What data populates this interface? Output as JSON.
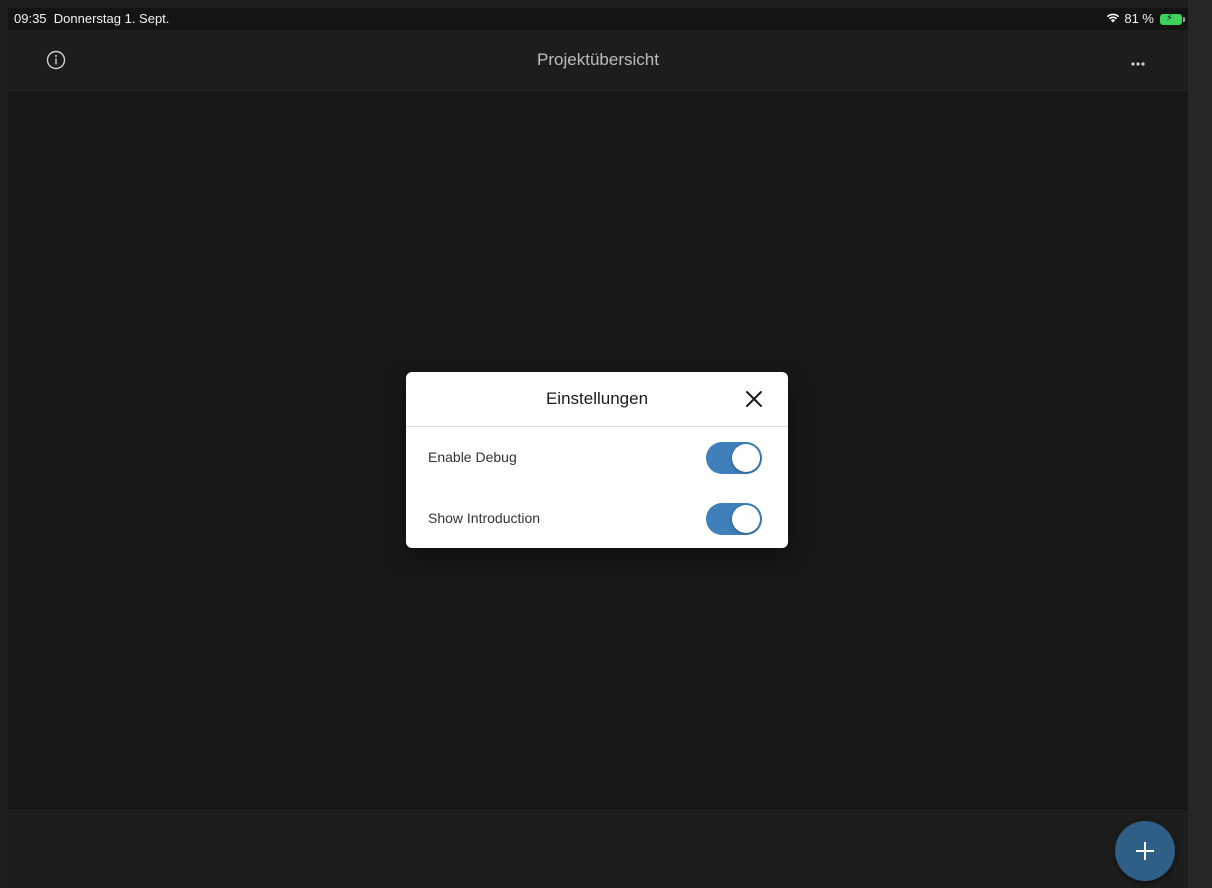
{
  "status_bar": {
    "time": "09:35",
    "date": "Donnerstag 1. Sept.",
    "wifi_icon": "wifi-icon",
    "battery_percent": "81 %",
    "battery_icon": "battery-charging-icon"
  },
  "navbar": {
    "title": "Projektübersicht",
    "info_icon": "info-icon",
    "more_icon": "more-horizontal-icon"
  },
  "settings_dialog": {
    "title": "Einstellungen",
    "close_icon": "close-icon",
    "options": [
      {
        "label": "Enable Debug",
        "enabled": true
      },
      {
        "label": "Show Introduction",
        "enabled": true
      }
    ]
  },
  "fab": {
    "icon": "plus-icon"
  },
  "colors": {
    "background": "#181818",
    "toggle_on": "#3f7fba",
    "fab": "#2f5e86",
    "battery": "#3bd15b"
  }
}
